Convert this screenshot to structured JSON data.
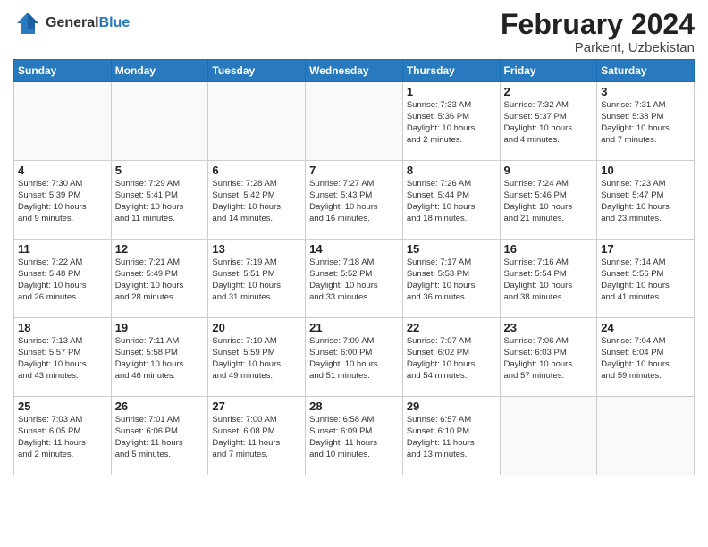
{
  "header": {
    "logo_general": "General",
    "logo_blue": "Blue",
    "month_title": "February 2024",
    "location": "Parkent, Uzbekistan"
  },
  "days_of_week": [
    "Sunday",
    "Monday",
    "Tuesday",
    "Wednesday",
    "Thursday",
    "Friday",
    "Saturday"
  ],
  "weeks": [
    [
      {
        "day": "",
        "info": ""
      },
      {
        "day": "",
        "info": ""
      },
      {
        "day": "",
        "info": ""
      },
      {
        "day": "",
        "info": ""
      },
      {
        "day": "1",
        "info": "Sunrise: 7:33 AM\nSunset: 5:36 PM\nDaylight: 10 hours\nand 2 minutes."
      },
      {
        "day": "2",
        "info": "Sunrise: 7:32 AM\nSunset: 5:37 PM\nDaylight: 10 hours\nand 4 minutes."
      },
      {
        "day": "3",
        "info": "Sunrise: 7:31 AM\nSunset: 5:38 PM\nDaylight: 10 hours\nand 7 minutes."
      }
    ],
    [
      {
        "day": "4",
        "info": "Sunrise: 7:30 AM\nSunset: 5:39 PM\nDaylight: 10 hours\nand 9 minutes."
      },
      {
        "day": "5",
        "info": "Sunrise: 7:29 AM\nSunset: 5:41 PM\nDaylight: 10 hours\nand 11 minutes."
      },
      {
        "day": "6",
        "info": "Sunrise: 7:28 AM\nSunset: 5:42 PM\nDaylight: 10 hours\nand 14 minutes."
      },
      {
        "day": "7",
        "info": "Sunrise: 7:27 AM\nSunset: 5:43 PM\nDaylight: 10 hours\nand 16 minutes."
      },
      {
        "day": "8",
        "info": "Sunrise: 7:26 AM\nSunset: 5:44 PM\nDaylight: 10 hours\nand 18 minutes."
      },
      {
        "day": "9",
        "info": "Sunrise: 7:24 AM\nSunset: 5:46 PM\nDaylight: 10 hours\nand 21 minutes."
      },
      {
        "day": "10",
        "info": "Sunrise: 7:23 AM\nSunset: 5:47 PM\nDaylight: 10 hours\nand 23 minutes."
      }
    ],
    [
      {
        "day": "11",
        "info": "Sunrise: 7:22 AM\nSunset: 5:48 PM\nDaylight: 10 hours\nand 26 minutes."
      },
      {
        "day": "12",
        "info": "Sunrise: 7:21 AM\nSunset: 5:49 PM\nDaylight: 10 hours\nand 28 minutes."
      },
      {
        "day": "13",
        "info": "Sunrise: 7:19 AM\nSunset: 5:51 PM\nDaylight: 10 hours\nand 31 minutes."
      },
      {
        "day": "14",
        "info": "Sunrise: 7:18 AM\nSunset: 5:52 PM\nDaylight: 10 hours\nand 33 minutes."
      },
      {
        "day": "15",
        "info": "Sunrise: 7:17 AM\nSunset: 5:53 PM\nDaylight: 10 hours\nand 36 minutes."
      },
      {
        "day": "16",
        "info": "Sunrise: 7:16 AM\nSunset: 5:54 PM\nDaylight: 10 hours\nand 38 minutes."
      },
      {
        "day": "17",
        "info": "Sunrise: 7:14 AM\nSunset: 5:56 PM\nDaylight: 10 hours\nand 41 minutes."
      }
    ],
    [
      {
        "day": "18",
        "info": "Sunrise: 7:13 AM\nSunset: 5:57 PM\nDaylight: 10 hours\nand 43 minutes."
      },
      {
        "day": "19",
        "info": "Sunrise: 7:11 AM\nSunset: 5:58 PM\nDaylight: 10 hours\nand 46 minutes."
      },
      {
        "day": "20",
        "info": "Sunrise: 7:10 AM\nSunset: 5:59 PM\nDaylight: 10 hours\nand 49 minutes."
      },
      {
        "day": "21",
        "info": "Sunrise: 7:09 AM\nSunset: 6:00 PM\nDaylight: 10 hours\nand 51 minutes."
      },
      {
        "day": "22",
        "info": "Sunrise: 7:07 AM\nSunset: 6:02 PM\nDaylight: 10 hours\nand 54 minutes."
      },
      {
        "day": "23",
        "info": "Sunrise: 7:06 AM\nSunset: 6:03 PM\nDaylight: 10 hours\nand 57 minutes."
      },
      {
        "day": "24",
        "info": "Sunrise: 7:04 AM\nSunset: 6:04 PM\nDaylight: 10 hours\nand 59 minutes."
      }
    ],
    [
      {
        "day": "25",
        "info": "Sunrise: 7:03 AM\nSunset: 6:05 PM\nDaylight: 11 hours\nand 2 minutes."
      },
      {
        "day": "26",
        "info": "Sunrise: 7:01 AM\nSunset: 6:06 PM\nDaylight: 11 hours\nand 5 minutes."
      },
      {
        "day": "27",
        "info": "Sunrise: 7:00 AM\nSunset: 6:08 PM\nDaylight: 11 hours\nand 7 minutes."
      },
      {
        "day": "28",
        "info": "Sunrise: 6:58 AM\nSunset: 6:09 PM\nDaylight: 11 hours\nand 10 minutes."
      },
      {
        "day": "29",
        "info": "Sunrise: 6:57 AM\nSunset: 6:10 PM\nDaylight: 11 hours\nand 13 minutes."
      },
      {
        "day": "",
        "info": ""
      },
      {
        "day": "",
        "info": ""
      }
    ]
  ]
}
